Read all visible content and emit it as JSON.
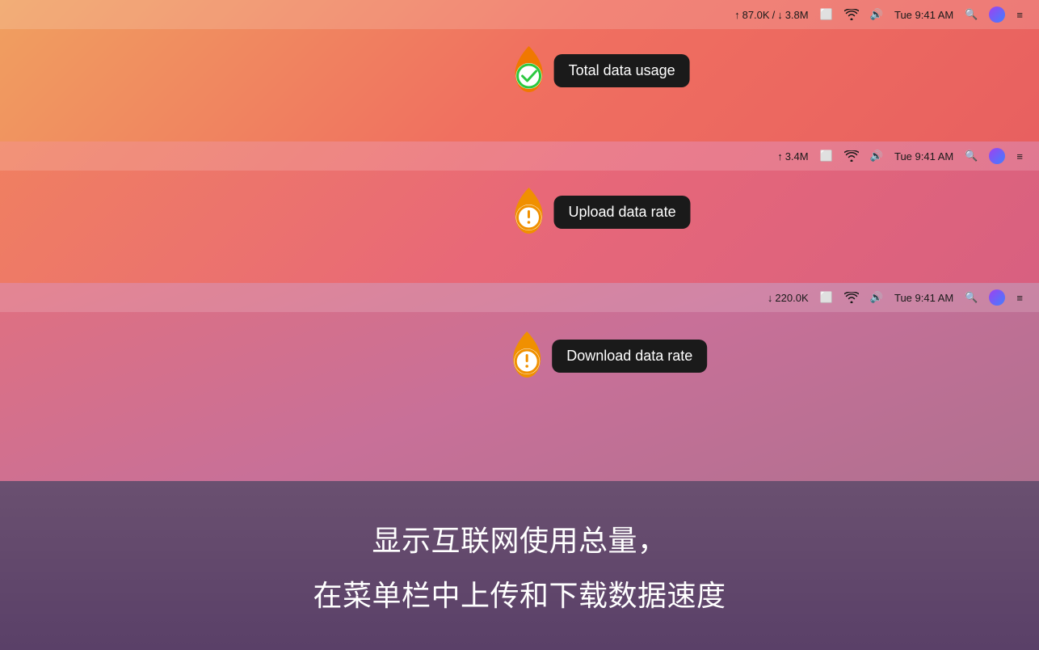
{
  "sections": {
    "section1": {
      "menubar": {
        "upload": "87.0K",
        "download": "3.8M",
        "time": "Tue 9:41 AM"
      },
      "tooltip": "Total data usage",
      "icon_type": "check"
    },
    "section2": {
      "menubar": {
        "upload": "3.4M",
        "time": "Tue 9:41 AM"
      },
      "tooltip": "Upload data rate",
      "icon_type": "warning"
    },
    "section3": {
      "menubar": {
        "download": "220.0K",
        "time": "Tue 9:41 AM"
      },
      "tooltip": "Download data rate",
      "icon_type": "warning"
    }
  },
  "bottom": {
    "line1": "显示互联网使用总量，",
    "line2": "在菜单栏中上传和下载数据速度"
  },
  "icons": {
    "up_arrow": "↑",
    "down_arrow": "↓",
    "monitor": "⊡",
    "wifi": "WiFi",
    "volume": "🔊",
    "search": "🔍",
    "hamburger": "≡"
  }
}
